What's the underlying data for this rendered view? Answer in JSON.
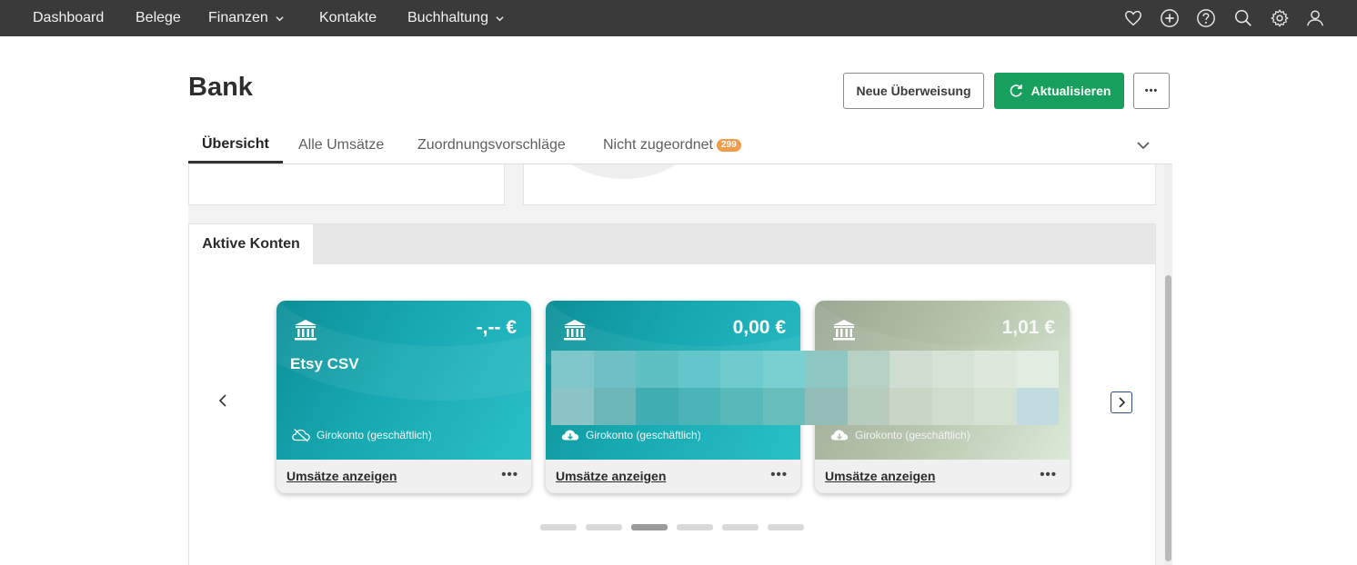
{
  "nav": {
    "items": [
      {
        "label": "Dashboard",
        "dropdown": false
      },
      {
        "label": "Belege",
        "dropdown": false
      },
      {
        "label": "Finanzen",
        "dropdown": true
      },
      {
        "label": "Kontakte",
        "dropdown": false
      },
      {
        "label": "Buchhaltung",
        "dropdown": true
      }
    ],
    "icons": [
      "heart-icon",
      "plus-circle-icon",
      "help-icon",
      "search-icon",
      "gear-icon",
      "user-icon"
    ]
  },
  "page": {
    "title": "Bank",
    "new_transfer_label": "Neue Überweisung",
    "refresh_label": "Aktualisieren",
    "more_label": "•••"
  },
  "tabs": [
    {
      "label": "Übersicht",
      "active": true
    },
    {
      "label": "Alle Umsätze",
      "active": false
    },
    {
      "label": "Zuordnungsvorschläge",
      "active": false
    },
    {
      "label": "Nicht zugeordnet",
      "active": false,
      "badge": "299"
    }
  ],
  "accounts": {
    "tab_label": "Aktive Konten",
    "cards": [
      {
        "name": "Etsy CSV",
        "amount": "-,-- €",
        "type": "Girokonto (geschäftlich)",
        "sync": "cloud-off-icon",
        "link": "Umsätze anzeigen",
        "more": "•••",
        "theme": "teal"
      },
      {
        "name": "",
        "amount": "0,00 €",
        "type": "Girokonto (geschäftlich)",
        "sync": "cloud-download-icon",
        "link": "Umsätze anzeigen",
        "more": "•••",
        "theme": "teal"
      },
      {
        "name": "",
        "amount": "1,01 €",
        "type": "Girokonto (geschäftlich)",
        "sync": "cloud-download-icon",
        "link": "Umsätze anzeigen",
        "more": "•••",
        "theme": "sage"
      }
    ],
    "pagination": {
      "count": 6,
      "active_index": 2
    }
  },
  "colors": {
    "nav_bg": "#3a3a3a",
    "primary": "#17a05d",
    "badge": "#f29c4d",
    "card_teal": "#17a9b1",
    "card_sage": "#b7c5ad"
  }
}
